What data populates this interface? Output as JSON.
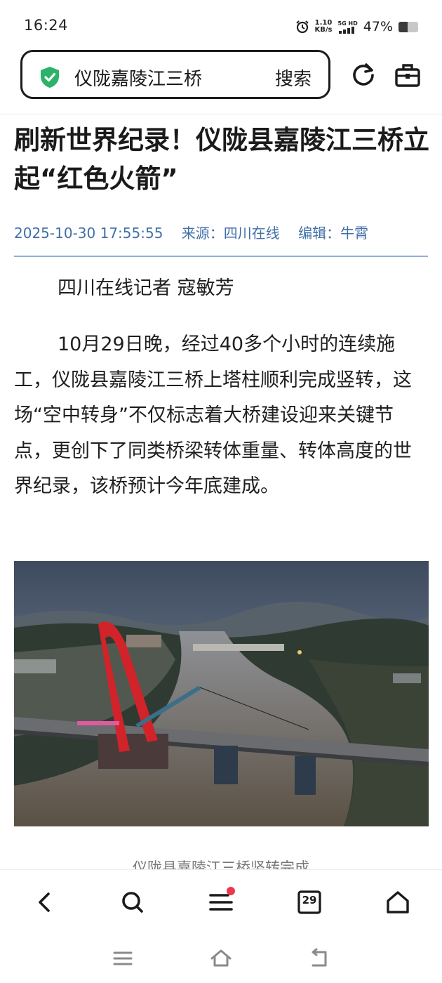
{
  "status_bar": {
    "time": "16:24",
    "net_speed_value": "1.10",
    "net_speed_unit": "KB/s",
    "signal_label": "5G HD",
    "battery_percent_text": "47%",
    "battery_level": 0.47,
    "icons": [
      "alarm-icon",
      "signal-icon",
      "battery-icon"
    ]
  },
  "search_bar": {
    "query": "仪陇嘉陵江三桥",
    "search_button": "搜索",
    "secure_icon": "shield-check-icon",
    "accent": "#2cb36a"
  },
  "top_actions": [
    "refresh-icon",
    "toolbox-icon"
  ],
  "article": {
    "title": "刷新世界纪录！仪陇县嘉陵江三桥立起“红色火箭”",
    "datetime": "2025-10-30 17:55:55",
    "source": "来源：四川在线",
    "editor": "编辑：牛霄",
    "byline": "四川在线记者 寇敏芳",
    "paragraph_1": "10月29日晚，经过40多个小时的连续施工，仪陇县嘉陵江三桥上塔柱顺利完成竖转，这场“空中转身”不仅标志着大桥建设迎来关键节点，更创下了同类桥梁转体重量、转体高度的世界纪录，该桥预计今年底建成。",
    "photo_caption": "仪陇县嘉陵江三桥竖转完成",
    "meta_color": "#3f6fa8"
  },
  "bottom_toolbar": {
    "items": [
      "back-icon",
      "search-icon",
      "menu-icon",
      "tabs-icon",
      "home-icon"
    ],
    "tab_count": "29",
    "menu_has_notification": true,
    "notification_color": "#f0364a"
  },
  "system_nav": [
    "recents-icon",
    "home-nav-icon",
    "back-nav-icon"
  ]
}
